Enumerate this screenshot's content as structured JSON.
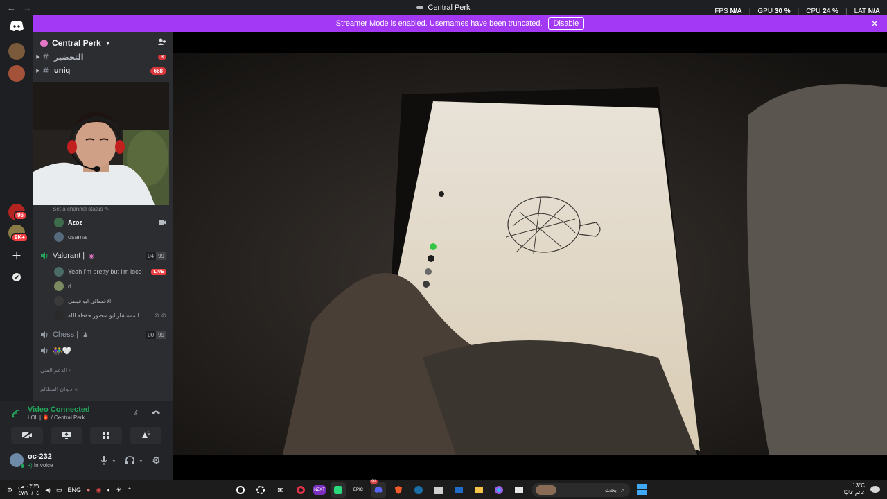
{
  "window": {
    "title": "Central Perk",
    "back": "←",
    "forward": "→"
  },
  "overlay": {
    "fps_label": "FPS",
    "fps_value": "N/A",
    "gpu_label": "GPU",
    "gpu_value": "30 %",
    "cpu_label": "CPU",
    "cpu_value": "24 %",
    "lat_label": "LAT",
    "lat_value": "N/A"
  },
  "banner": {
    "message": "Streamer Mode is enabled. Usernames have been truncated.",
    "button": "Disable",
    "close": "✕"
  },
  "rail": {
    "badges": [
      "96",
      "9K+"
    ]
  },
  "server": {
    "name": "Central Perk"
  },
  "channels": [
    {
      "name": "التحضير",
      "count": "3"
    },
    {
      "name": "uniq",
      "count": "668"
    }
  ],
  "channel_status_hint": "Set a channel status",
  "voice_users_top": [
    {
      "name": "Azoz"
    },
    {
      "name": "osama"
    }
  ],
  "voice_channels": [
    {
      "name": "Valorant |",
      "limit": [
        "04",
        "99"
      ],
      "users": [
        {
          "name": "Yeah i'm pretty but i'm loco",
          "live": "LIVE"
        },
        {
          "name": "d..."
        },
        {
          "name": "الاخصائي ابو فيصل"
        },
        {
          "name": "المستشار ابو منصور حفظه الله"
        }
      ]
    },
    {
      "name": "Chess |",
      "limit": [
        "00",
        "99"
      ],
      "users": []
    },
    {
      "name": "👫🤍",
      "limit": [],
      "users": []
    }
  ],
  "categories": [
    "الدعم الفني",
    "ديوان المظالم"
  ],
  "voice_panel": {
    "status": "Video Connected",
    "location": "LOL | 🏮 / Central Perk"
  },
  "user": {
    "name": "oc-232",
    "status": "In voice"
  },
  "taskbar": {
    "time": "٠٣:٣١ ص",
    "date": "٤٧/١٠/٠٤",
    "lang": "ENG",
    "search_placeholder": "بحث",
    "weather_temp": "13°C",
    "weather_text": "غائم غالبًا",
    "discord_badge": "91"
  },
  "colors": {
    "blurple": "#5865f2",
    "streamer_banner": "#a339f5",
    "live_red": "#ed4245",
    "voice_green": "#23a55a"
  }
}
